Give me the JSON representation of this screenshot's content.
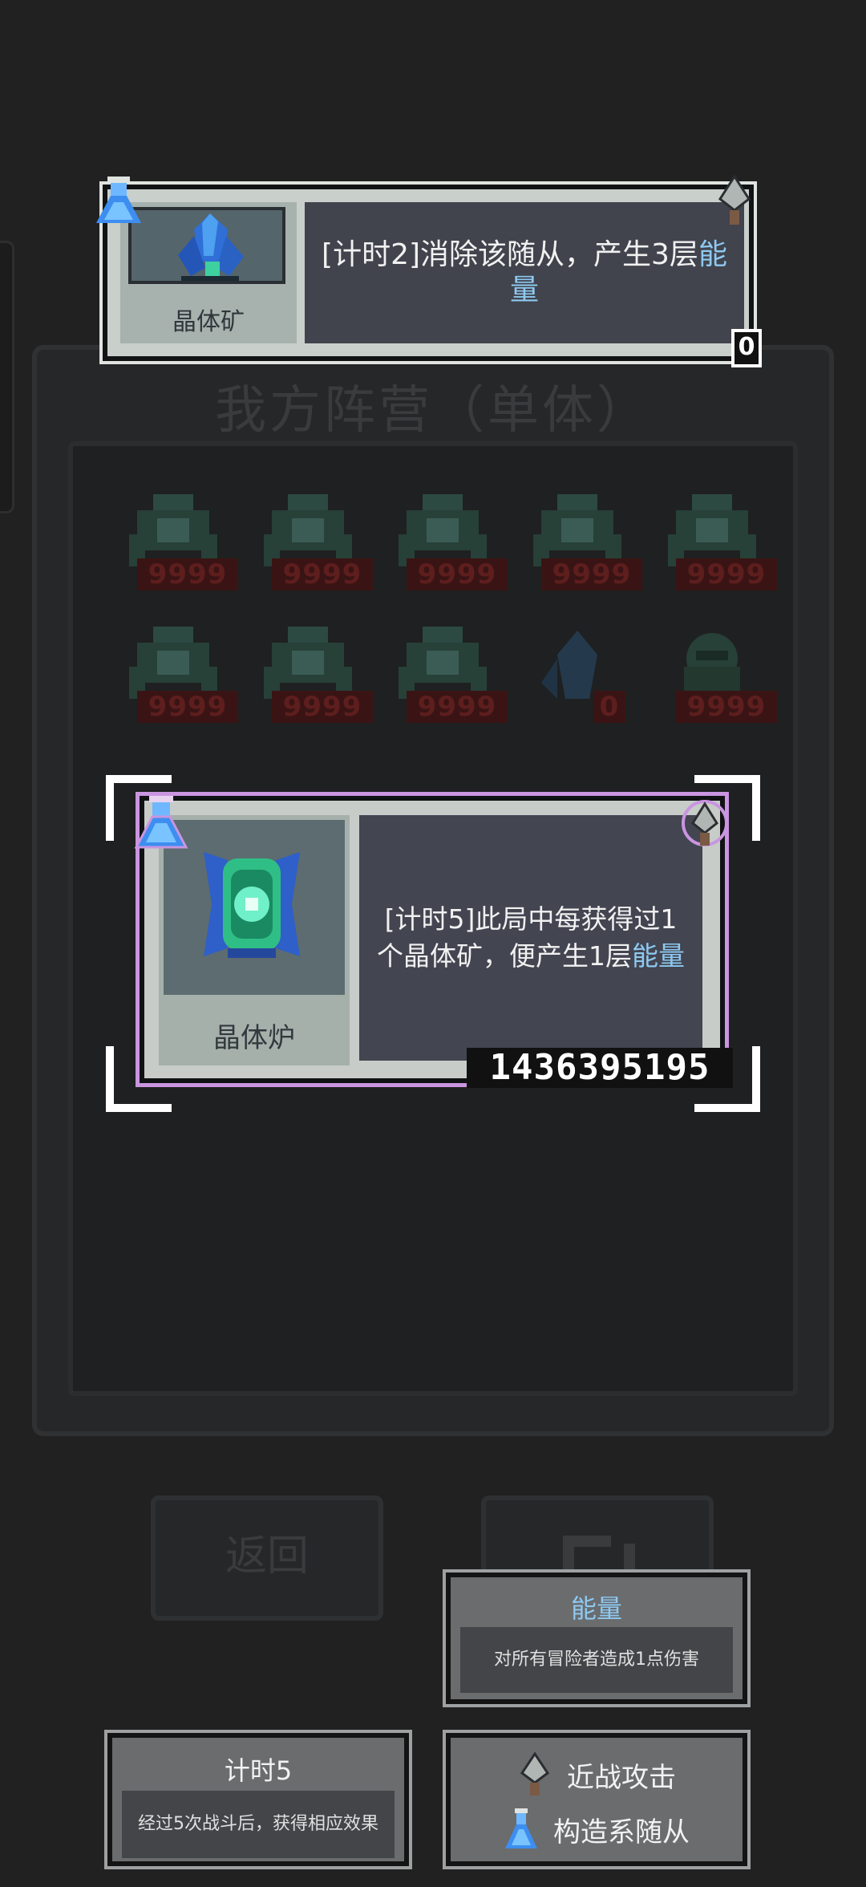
{
  "background": {
    "title": "我方阵营（单体）",
    "row1": [
      {
        "hp": "9999"
      },
      {
        "hp": "9999"
      },
      {
        "hp": "9999"
      },
      {
        "hp": "9999"
      },
      {
        "hp": "9999"
      }
    ],
    "row2": [
      {
        "hp": "9999"
      },
      {
        "hp": "9999"
      },
      {
        "hp": "9999"
      },
      {
        "hp": "0"
      },
      {
        "hp": "9999"
      }
    ]
  },
  "top_card": {
    "name": "晶体矿",
    "desc_prefix": "[计时2]消除该随从，产生3层",
    "keyword": "能量",
    "count": "0"
  },
  "featured_card": {
    "name": "晶体炉",
    "desc_prefix": "[计时5]此局中每获得过1个晶体矿，便产生1层",
    "keyword": "能量",
    "number": "1436395195"
  },
  "buttons": {
    "back_label": "返回"
  },
  "energy_tip": {
    "title": "能量",
    "body": "对所有冒险者造成1点伤害"
  },
  "timer_tip": {
    "title": "计时5",
    "body": "经过5次战斗后，获得相应效果"
  },
  "legend": {
    "melee_label": "近战攻击",
    "construct_label": "构造系随从"
  },
  "colors": {
    "keyword": "#8ec9f0",
    "card_frame": "#c995e0",
    "hp_ghost": "#3a1414"
  }
}
